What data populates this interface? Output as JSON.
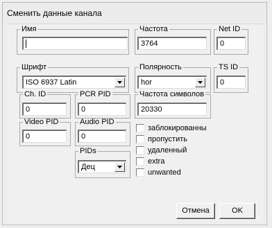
{
  "window": {
    "title": "Сменить данные канала"
  },
  "fields": {
    "name": {
      "label": "Имя",
      "value": ""
    },
    "frequency": {
      "label": "Частота",
      "value": "3764"
    },
    "net_id": {
      "label": "Net ID",
      "value": "0"
    },
    "font": {
      "label": "Шрифт",
      "value": "ISO 6937 Latin"
    },
    "polarity": {
      "label": "Полярность",
      "value": "hor"
    },
    "ts_id": {
      "label": "TS ID",
      "value": "0"
    },
    "ch_id": {
      "label": "Ch. ID",
      "value": "0"
    },
    "pcr_pid": {
      "label": "PCR PID",
      "value": "0"
    },
    "symbol_rate": {
      "label": "Частота символов",
      "value": "20330"
    },
    "video_pid": {
      "label": "Video PID",
      "value": "0"
    },
    "audio_pid": {
      "label": "Audio PID",
      "value": "0"
    },
    "pids": {
      "label": "PIDs",
      "value": "Дец"
    }
  },
  "checkboxes": [
    {
      "label": "заблокированны",
      "checked": false
    },
    {
      "label": "пропустить",
      "checked": false
    },
    {
      "label": "удаленный",
      "checked": false
    },
    {
      "label": "extra",
      "checked": false
    },
    {
      "label": "unwanted",
      "checked": false
    }
  ],
  "buttons": {
    "cancel": "Отмена",
    "ok": "OK"
  },
  "icons": {
    "dropdown": "chevron-down-icon"
  }
}
